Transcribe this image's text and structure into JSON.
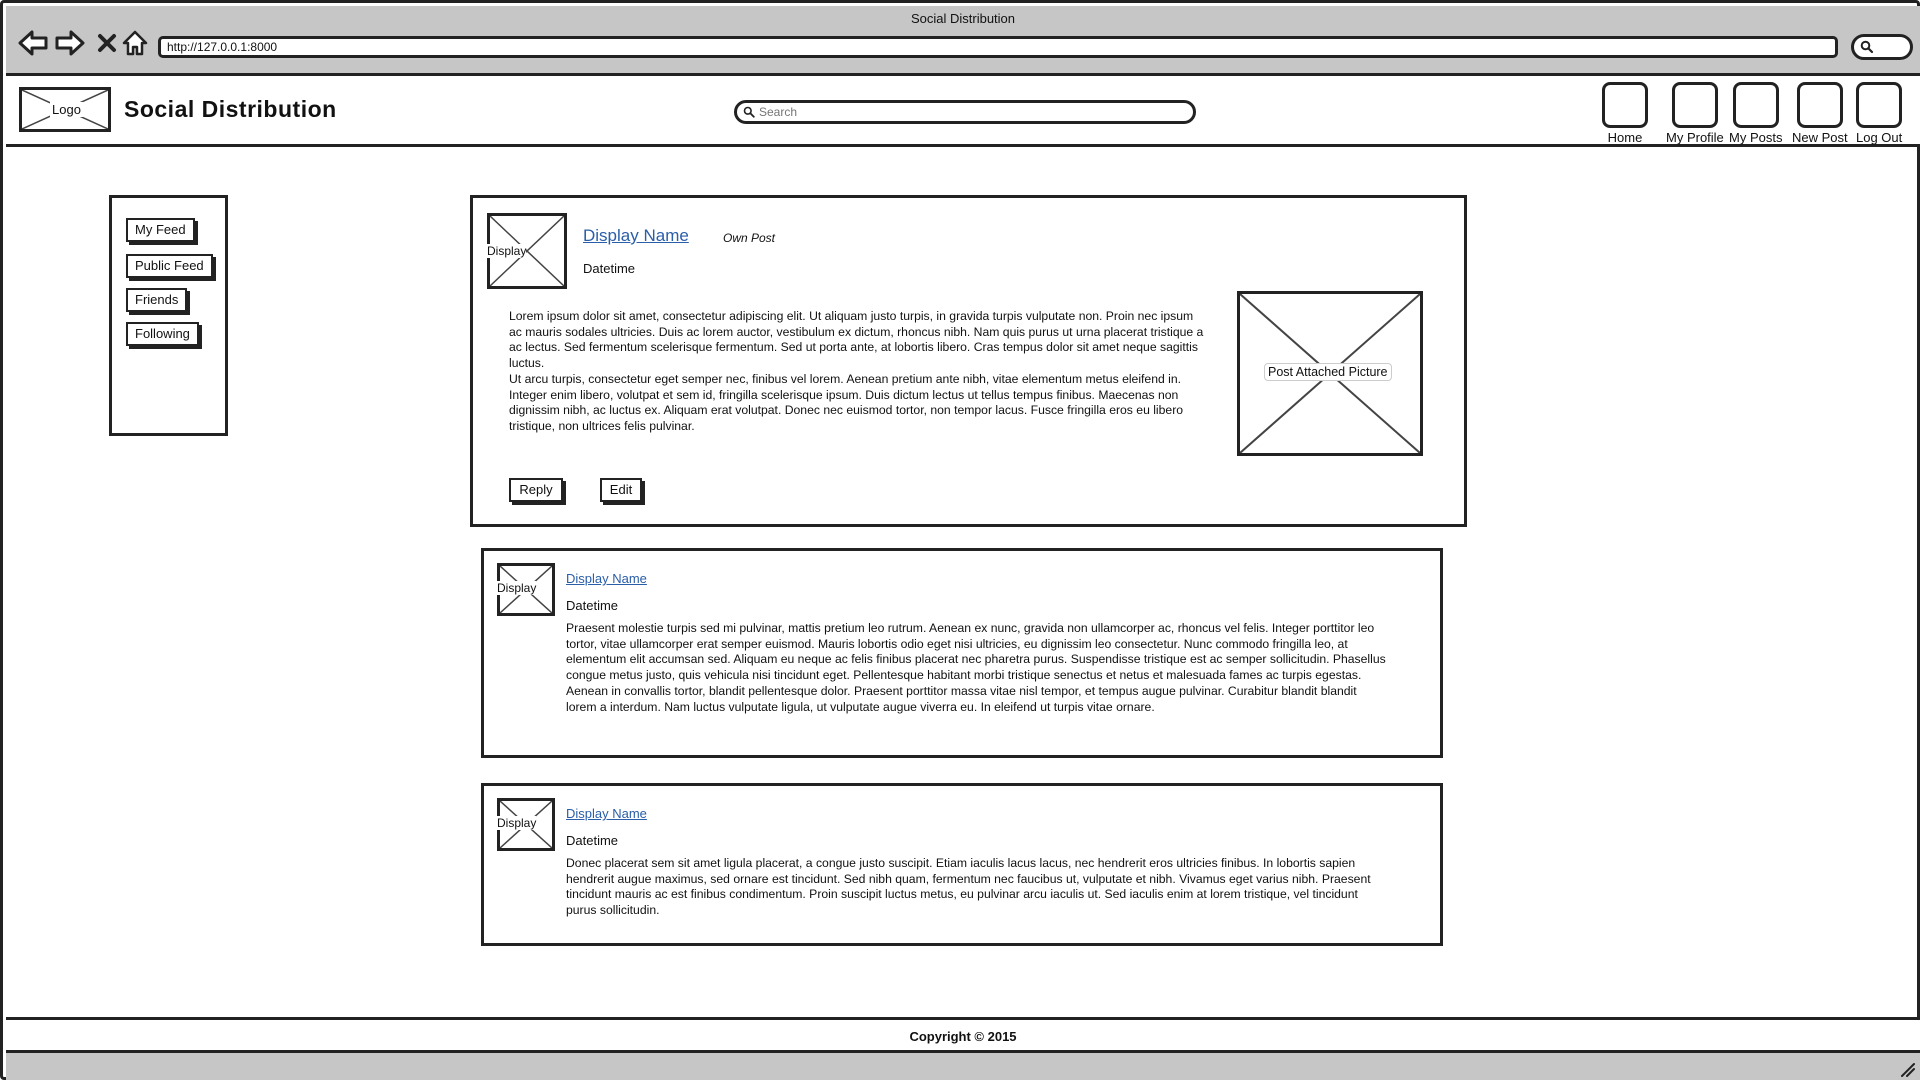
{
  "browser": {
    "window_title": "Social Distribution",
    "url": "http://127.0.0.1:8000"
  },
  "header": {
    "logo_label": "Logo",
    "app_title": "Social Distribution",
    "search_placeholder": "Search",
    "nav": [
      {
        "label": "Home",
        "icon": "home-icon"
      },
      {
        "label": "My Profile",
        "icon": "profile-icon"
      },
      {
        "label": "My Posts",
        "icon": "posts-icon"
      },
      {
        "label": "New Post",
        "icon": "new-post-icon"
      },
      {
        "label": "Log Out",
        "icon": "logout-icon"
      }
    ]
  },
  "sidebar": {
    "items": [
      {
        "label": "My Feed"
      },
      {
        "label": "Public Feed"
      },
      {
        "label": "Friends"
      },
      {
        "label": "Following"
      }
    ]
  },
  "main_post": {
    "avatar_label": "Display",
    "display_name": "Display Name",
    "tag": "Own Post",
    "datetime": "Datetime",
    "paragraph_1": "Lorem ipsum dolor sit amet, consectetur adipiscing elit. Ut aliquam justo turpis, in gravida turpis vulputate non. Proin nec ipsum ac mauris sodales ultricies. Duis ac lorem auctor, vestibulum ex dictum, rhoncus nibh. Nam quis purus ut urna placerat tristique a ac lectus. Sed fermentum scelerisque fermentum. Sed ut porta ante, at lobortis libero. Cras tempus dolor sit amet neque sagittis luctus.",
    "paragraph_2": "Ut arcu turpis, consectetur eget semper nec, finibus vel lorem. Aenean pretium ante nibh, vitae elementum metus eleifend in. Integer enim libero, volutpat et sem id, fringilla scelerisque ipsum. Duis dictum lectus ut tellus tempus finibus. Maecenas non dignissim nibh, ac luctus ex. Aliquam erat volutpat. Donec nec euismod tortor, non tempor lacus. Fusce fringilla eros eu libero tristique, non ultrices felis pulvinar.",
    "picture_label": "Post Attached Picture",
    "reply_label": "Reply",
    "edit_label": "Edit"
  },
  "comments": [
    {
      "avatar_label": "Display",
      "display_name": "Display Name",
      "datetime": "Datetime",
      "body": "Praesent molestie turpis sed mi pulvinar, mattis pretium leo rutrum. Aenean ex nunc, gravida non ullamcorper ac, rhoncus vel felis. Integer porttitor leo tortor, vitae ullamcorper erat semper euismod. Mauris lobortis odio eget nisi ultricies, eu dignissim leo consectetur. Nunc commodo fringilla leo, at elementum elit accumsan sed. Aliquam eu neque ac felis finibus placerat nec pharetra purus. Suspendisse tristique est ac semper sollicitudin. Phasellus congue metus justo, quis vehicula nisi tincidunt eget. Pellentesque habitant morbi tristique senectus et netus et malesuada fames ac turpis egestas. Aenean in convallis tortor, blandit pellentesque dolor. Praesent porttitor massa vitae nisl tempor, et tempus augue pulvinar. Curabitur blandit blandit lorem a interdum. Nam luctus vulputate ligula, ut vulputate augue viverra eu. In eleifend ut turpis vitae ornare."
    },
    {
      "avatar_label": "Display",
      "display_name": "Display Name",
      "datetime": "Datetime",
      "body": "Donec placerat sem sit amet ligula placerat, a congue justo suscipit. Etiam iaculis lacus lacus, nec hendrerit eros ultricies finibus. In lobortis sapien hendrerit augue maximus, sed ornare est tincidunt. Sed nibh quam, fermentum nec faucibus ut, vulputate et nibh. Vivamus eget varius nibh. Praesent tincidunt mauris ac est finibus condimentum. Proin suscipit luctus metus, eu pulvinar arcu iaculis ut. Sed iaculis enim at lorem tristique, vel tincidunt purus sollicitudin."
    }
  ],
  "footer": {
    "copyright": "Copyright © 2015"
  }
}
